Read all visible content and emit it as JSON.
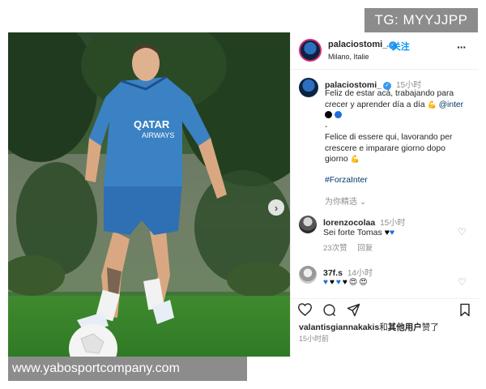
{
  "watermark": {
    "top": "TG: MYYJJPP",
    "bottom": "www.yabosportcompany.com"
  },
  "post": {
    "username": "palaciostomi_",
    "follow_label": "关注",
    "location": "Milano, Italie",
    "more_icon": "more-icon",
    "caption": {
      "time": "15小时",
      "line1": "Feliz de estar acá, trabajando para",
      "line2": "crecer y aprender día a día",
      "mention": "@inter",
      "dash": "-",
      "it_line1": "Felice di essere qui, lavorando per",
      "it_line2": "crescere e imparare giorno dopo",
      "it_line3": "giorno",
      "hashtag": "#ForzaInter",
      "translate": "为你精选",
      "dot_colors": [
        "#000000",
        "#1d6fd9"
      ]
    },
    "comments": [
      {
        "username": "lorenzocolaa",
        "time": "15小时",
        "text": "Sei forte Tomas",
        "likes": "23次赞",
        "reply": "回复"
      },
      {
        "username": "37f.s",
        "time": "14小时"
      }
    ],
    "actions": [
      "heart-icon",
      "comment-icon",
      "share-icon",
      "bookmark-icon"
    ],
    "liked_by_user": "valantisgiannakakis",
    "liked_by_and": "和",
    "liked_by_others": "其他用户",
    "liked_by_suffix": "赞了",
    "posted": "15小时前"
  },
  "colors": {
    "link": "#0095f6",
    "verified": "#3897f0",
    "mention": "#00376b",
    "muted": "#8e8e8e"
  }
}
